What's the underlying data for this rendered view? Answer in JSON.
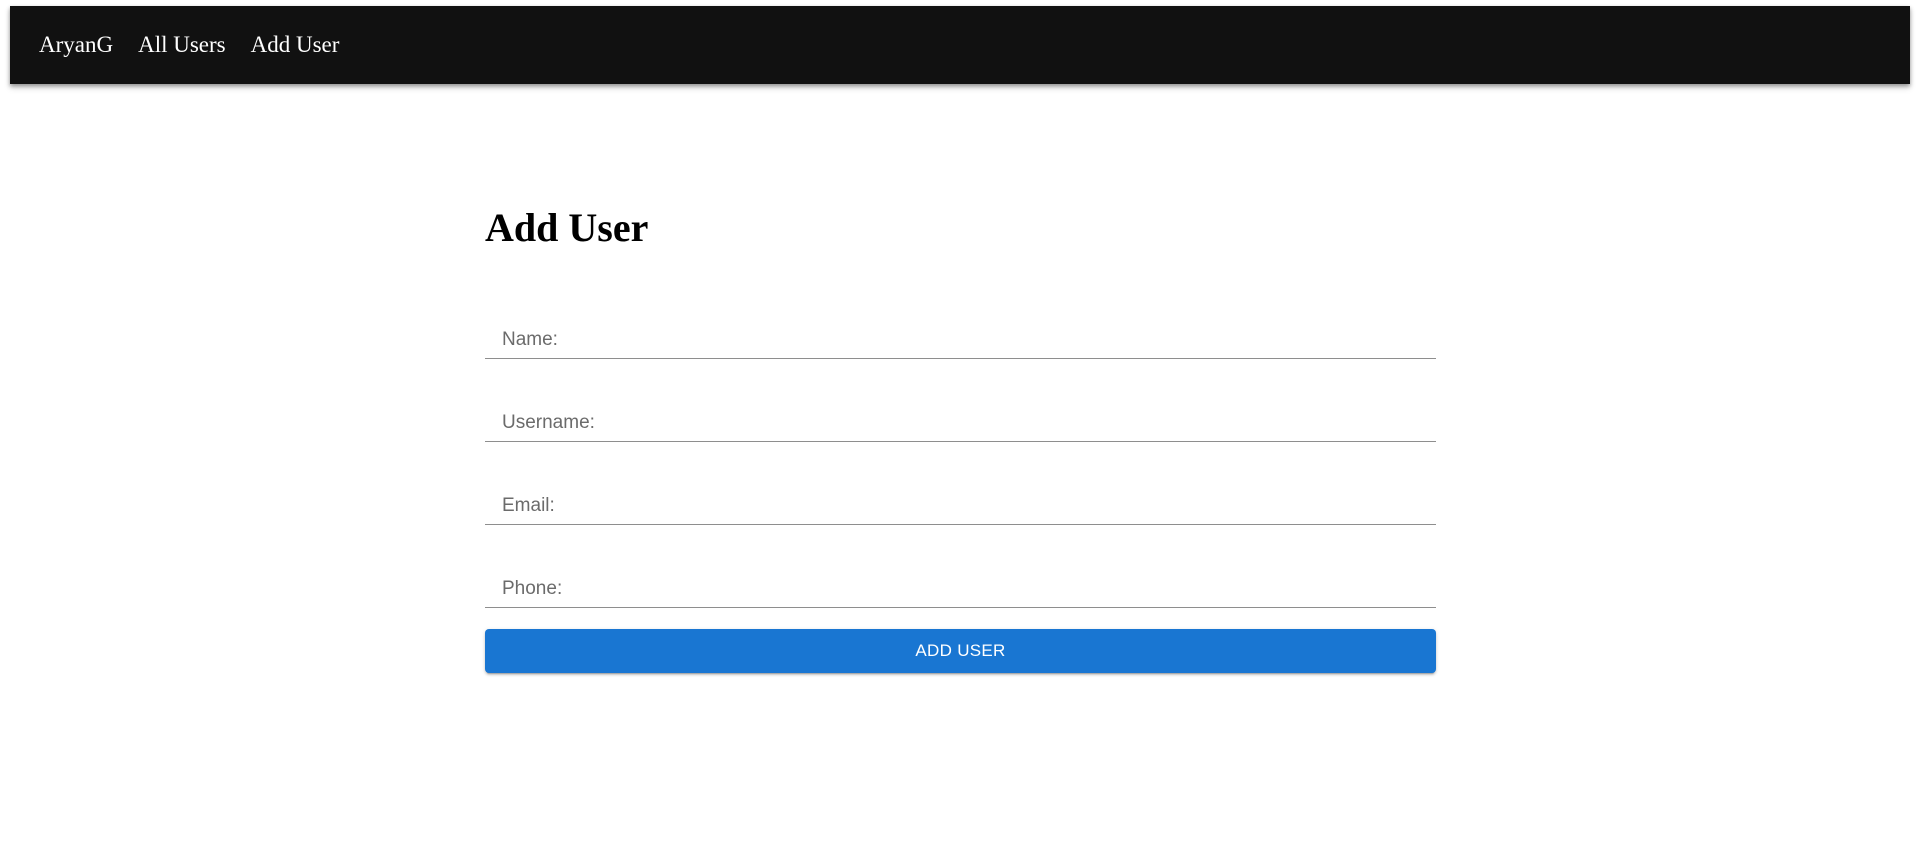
{
  "navbar": {
    "brand": "AryanG",
    "links": [
      "All Users",
      "Add User"
    ]
  },
  "form": {
    "title": "Add User",
    "fields": [
      {
        "placeholder": "Name:",
        "value": ""
      },
      {
        "placeholder": "Username:",
        "value": ""
      },
      {
        "placeholder": "Email:",
        "value": ""
      },
      {
        "placeholder": "Phone:",
        "value": ""
      }
    ],
    "submit_label": "Add User"
  },
  "colors": {
    "appbar": "#111111",
    "primary": "#1976d2"
  }
}
